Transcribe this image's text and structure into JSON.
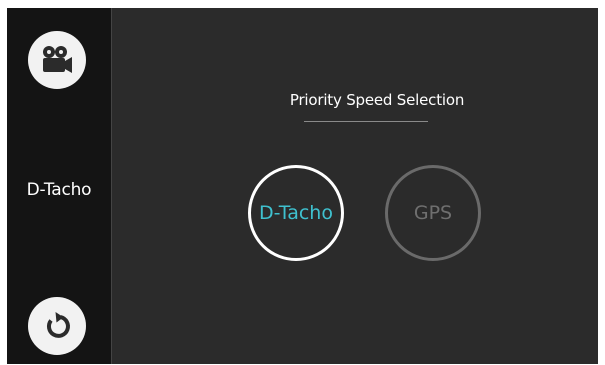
{
  "sidebar": {
    "camera_icon": "video-camera-icon",
    "current_mode_label": "D-Tacho",
    "reset_icon": "rotate-icon"
  },
  "main": {
    "title": "Priority Speed Selection",
    "options": [
      {
        "label": "D-Tacho",
        "selected": true,
        "color": "#3fc1cf"
      },
      {
        "label": "GPS",
        "selected": false,
        "color": "#6f6f6f"
      }
    ]
  }
}
